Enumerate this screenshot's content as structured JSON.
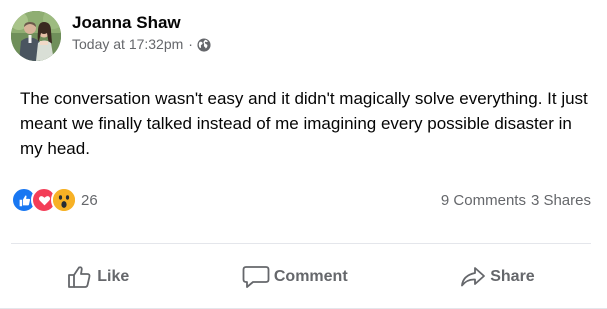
{
  "post": {
    "author": "Joanna Shaw",
    "timestamp": "Today at 17:32pm",
    "separator": "·",
    "privacy_icon": "globe-icon",
    "text": "The conversation wasn't easy and it didn't magically solve everything. It just meant we finally talked instead of me imagining every possible disaster in my head."
  },
  "reactions": {
    "icons": [
      "like-reaction-icon",
      "love-reaction-icon",
      "wow-reaction-icon"
    ],
    "count": "26",
    "colors": {
      "like": "#1877f2",
      "love": "#f33e58",
      "wow": "#f7b125"
    }
  },
  "engagement": {
    "comments": "9 Comments",
    "shares": "3 Shares"
  },
  "actions": {
    "like_label": "Like",
    "comment_label": "Comment",
    "share_label": "Share"
  },
  "colors": {
    "text_primary": "#050505",
    "text_secondary": "#65676b",
    "divider": "#e4e6eb"
  }
}
